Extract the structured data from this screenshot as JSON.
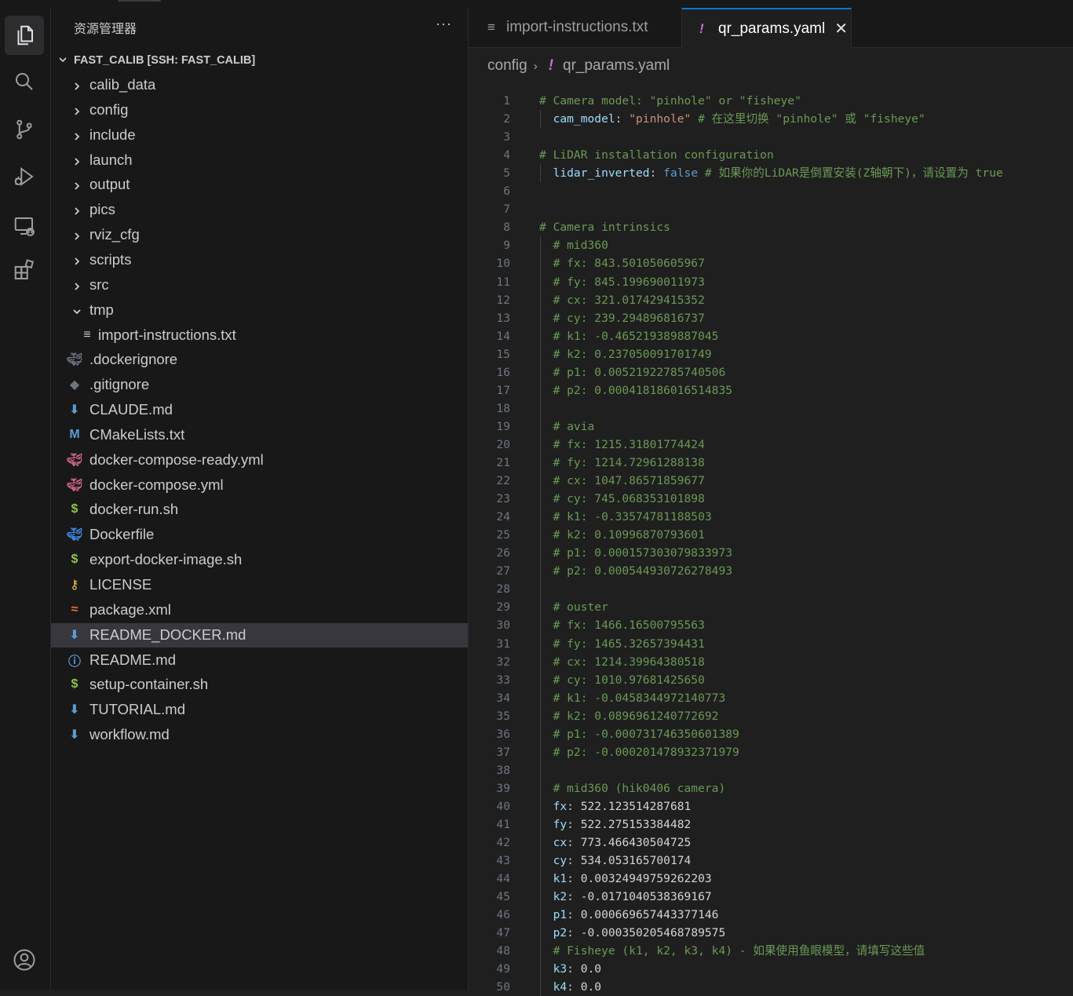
{
  "sidebar": {
    "title": "资源管理器",
    "more": "···",
    "root_label": "FAST_CALIB [SSH: FAST_CALIB]",
    "items": [
      {
        "label": "calib_data",
        "kind": "folder"
      },
      {
        "label": "config",
        "kind": "folder"
      },
      {
        "label": "include",
        "kind": "folder"
      },
      {
        "label": "launch",
        "kind": "folder"
      },
      {
        "label": "output",
        "kind": "folder"
      },
      {
        "label": "pics",
        "kind": "folder"
      },
      {
        "label": "rviz_cfg",
        "kind": "folder"
      },
      {
        "label": "scripts",
        "kind": "folder"
      },
      {
        "label": "src",
        "kind": "folder"
      },
      {
        "label": "tmp",
        "kind": "folder-open"
      },
      {
        "label": "import-instructions.txt",
        "kind": "text",
        "depth": 2
      },
      {
        "label": ".dockerignore",
        "kind": "docker-grey"
      },
      {
        "label": ".gitignore",
        "kind": "git"
      },
      {
        "label": "CLAUDE.md",
        "kind": "markdown"
      },
      {
        "label": "CMakeLists.txt",
        "kind": "cmake"
      },
      {
        "label": "docker-compose-ready.yml",
        "kind": "docker-pink"
      },
      {
        "label": "docker-compose.yml",
        "kind": "docker-pink"
      },
      {
        "label": "docker-run.sh",
        "kind": "shell"
      },
      {
        "label": "Dockerfile",
        "kind": "docker-blue"
      },
      {
        "label": "export-docker-image.sh",
        "kind": "shell"
      },
      {
        "label": "LICENSE",
        "kind": "license"
      },
      {
        "label": "package.xml",
        "kind": "rss"
      },
      {
        "label": "README_DOCKER.md",
        "kind": "markdown",
        "selected": true
      },
      {
        "label": "README.md",
        "kind": "info"
      },
      {
        "label": "setup-container.sh",
        "kind": "shell"
      },
      {
        "label": "TUTORIAL.md",
        "kind": "markdown"
      },
      {
        "label": "workflow.md",
        "kind": "markdown"
      }
    ]
  },
  "tabs": [
    {
      "label": "import-instructions.txt",
      "icon": "≡",
      "active": false
    },
    {
      "label": "qr_params.yaml",
      "icon": "!",
      "active": true,
      "close": "✕"
    }
  ],
  "breadcrumb": {
    "folder": "config",
    "separator": "›",
    "icon": "!",
    "file": "qr_params.yaml"
  },
  "code_lines": [
    [
      {
        "t": "# Camera model: \"pinhole\" or \"fisheye\"",
        "c": "com"
      }
    ],
    [
      {
        "t": "  cam_model",
        "c": "key"
      },
      {
        "t": ": ",
        "c": "pun"
      },
      {
        "t": "\"pinhole\"",
        "c": "str"
      },
      {
        "t": " # 在这里切换 \"pinhole\" 或 \"fisheye\"",
        "c": "com"
      }
    ],
    [],
    [
      {
        "t": "# LiDAR installation configuration",
        "c": "com"
      }
    ],
    [
      {
        "t": "  lidar_inverted",
        "c": "key"
      },
      {
        "t": ": ",
        "c": "pun"
      },
      {
        "t": "false",
        "c": "kw"
      },
      {
        "t": " # 如果你的LiDAR是倒置安装(Z轴朝下)，请设置为 true",
        "c": "com"
      }
    ],
    [],
    [],
    [
      {
        "t": "# Camera intrinsics",
        "c": "com"
      }
    ],
    [
      {
        "t": "  # mid360",
        "c": "com"
      }
    ],
    [
      {
        "t": "  # fx: 843.501050605967",
        "c": "com"
      }
    ],
    [
      {
        "t": "  # fy: 845.199690011973",
        "c": "com"
      }
    ],
    [
      {
        "t": "  # cx: 321.017429415352",
        "c": "com"
      }
    ],
    [
      {
        "t": "  # cy: 239.294896816737",
        "c": "com"
      }
    ],
    [
      {
        "t": "  # k1: -0.465219389887045",
        "c": "com"
      }
    ],
    [
      {
        "t": "  # k2: 0.237050091701749",
        "c": "com"
      }
    ],
    [
      {
        "t": "  # p1: 0.00521922785740506",
        "c": "com"
      }
    ],
    [
      {
        "t": "  # p2: 0.000418186016514835",
        "c": "com"
      }
    ],
    [],
    [
      {
        "t": "  # avia",
        "c": "com"
      }
    ],
    [
      {
        "t": "  # fx: 1215.31801774424",
        "c": "com"
      }
    ],
    [
      {
        "t": "  # fy: 1214.72961288138",
        "c": "com"
      }
    ],
    [
      {
        "t": "  # cx: 1047.86571859677",
        "c": "com"
      }
    ],
    [
      {
        "t": "  # cy: 745.068353101898",
        "c": "com"
      }
    ],
    [
      {
        "t": "  # k1: -0.33574781188503",
        "c": "com"
      }
    ],
    [
      {
        "t": "  # k2: 0.10996870793601",
        "c": "com"
      }
    ],
    [
      {
        "t": "  # p1: 0.000157303079833973",
        "c": "com"
      }
    ],
    [
      {
        "t": "  # p2: 0.000544930726278493",
        "c": "com"
      }
    ],
    [],
    [
      {
        "t": "  # ouster",
        "c": "com"
      }
    ],
    [
      {
        "t": "  # fx: 1466.16500795563",
        "c": "com"
      }
    ],
    [
      {
        "t": "  # fy: 1465.32657394431",
        "c": "com"
      }
    ],
    [
      {
        "t": "  # cx: 1214.39964380518",
        "c": "com"
      }
    ],
    [
      {
        "t": "  # cy: 1010.97681425650",
        "c": "com"
      }
    ],
    [
      {
        "t": "  # k1: -0.0458344972140773",
        "c": "com"
      }
    ],
    [
      {
        "t": "  # k2: 0.0896961240772692",
        "c": "com"
      }
    ],
    [
      {
        "t": "  # p1: -0.000731746350601389",
        "c": "com"
      }
    ],
    [
      {
        "t": "  # p2: -0.000201478932371979",
        "c": "com"
      }
    ],
    [],
    [
      {
        "t": "  # mid360 (hik0406 camera)",
        "c": "com"
      }
    ],
    [
      {
        "t": "  fx",
        "c": "key"
      },
      {
        "t": ": ",
        "c": "pun"
      },
      {
        "t": "522.123514287681",
        "c": "numw"
      }
    ],
    [
      {
        "t": "  fy",
        "c": "key"
      },
      {
        "t": ": ",
        "c": "pun"
      },
      {
        "t": "522.275153384482",
        "c": "numw"
      }
    ],
    [
      {
        "t": "  cx",
        "c": "key"
      },
      {
        "t": ": ",
        "c": "pun"
      },
      {
        "t": "773.466430504725",
        "c": "numw"
      }
    ],
    [
      {
        "t": "  cy",
        "c": "key"
      },
      {
        "t": ": ",
        "c": "pun"
      },
      {
        "t": "534.053165700174",
        "c": "numw"
      }
    ],
    [
      {
        "t": "  k1",
        "c": "key"
      },
      {
        "t": ": ",
        "c": "pun"
      },
      {
        "t": "0.00324949759262203",
        "c": "numw"
      }
    ],
    [
      {
        "t": "  k2",
        "c": "key"
      },
      {
        "t": ": ",
        "c": "pun"
      },
      {
        "t": "-0.0171040538369167",
        "c": "numw"
      }
    ],
    [
      {
        "t": "  p1",
        "c": "key"
      },
      {
        "t": ": ",
        "c": "pun"
      },
      {
        "t": "0.000669657443377146",
        "c": "numw"
      }
    ],
    [
      {
        "t": "  p2",
        "c": "key"
      },
      {
        "t": ": ",
        "c": "pun"
      },
      {
        "t": "-0.000350205468789575",
        "c": "numw"
      }
    ],
    [
      {
        "t": "  # Fisheye (k1, k2, k3, k4) - 如果使用鱼眼模型，请填写这些值",
        "c": "com"
      }
    ],
    [
      {
        "t": "  k3",
        "c": "key"
      },
      {
        "t": ": ",
        "c": "pun"
      },
      {
        "t": "0.0",
        "c": "numw"
      }
    ],
    [
      {
        "t": "  k4",
        "c": "key"
      },
      {
        "t": ": ",
        "c": "pun"
      },
      {
        "t": "0.0",
        "c": "numw"
      }
    ]
  ],
  "activity_icons": [
    "explorer-icon",
    "search-icon",
    "source-control-icon",
    "run-debug-icon",
    "remote-explorer-icon",
    "extensions-icon",
    "account-icon"
  ]
}
